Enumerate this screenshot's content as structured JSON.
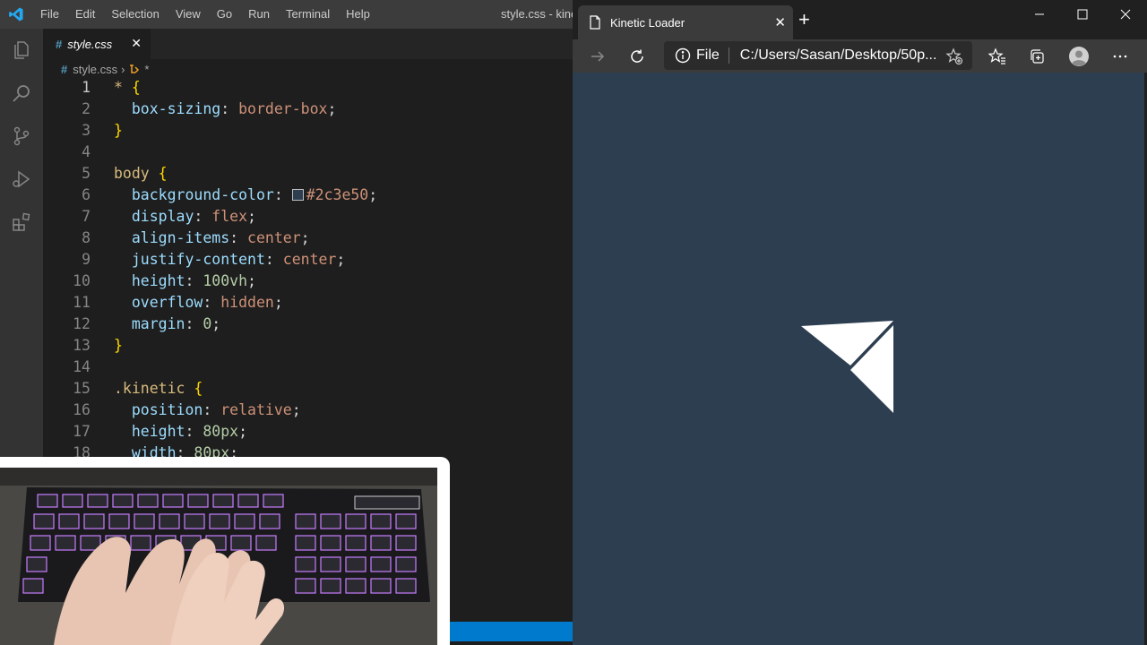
{
  "vscode": {
    "menu": [
      "File",
      "Edit",
      "Selection",
      "View",
      "Go",
      "Run",
      "Terminal",
      "Help"
    ],
    "window_title": "style.css - kinet",
    "tab": {
      "label": "style.css",
      "close": "✕"
    },
    "breadcrumb": {
      "file": "style.css",
      "selector": "*"
    },
    "lines": [
      {
        "n": "1",
        "tokens": [
          [
            "sel",
            "* "
          ],
          [
            "br",
            "{"
          ]
        ]
      },
      {
        "n": "2",
        "tokens": [
          [
            "txt",
            "  "
          ],
          [
            "prop",
            "box-sizing"
          ],
          [
            "txt",
            ": "
          ],
          [
            "val",
            "border-box"
          ],
          [
            "txt",
            ";"
          ]
        ]
      },
      {
        "n": "3",
        "tokens": [
          [
            "br",
            "}"
          ]
        ]
      },
      {
        "n": "4",
        "tokens": []
      },
      {
        "n": "5",
        "tokens": [
          [
            "sel",
            "body "
          ],
          [
            "br",
            "{"
          ]
        ]
      },
      {
        "n": "6",
        "tokens": [
          [
            "txt",
            "  "
          ],
          [
            "prop",
            "background-color"
          ],
          [
            "txt",
            ": "
          ],
          [
            "swatch",
            ""
          ],
          [
            "val",
            "#2c3e50"
          ],
          [
            "txt",
            ";"
          ]
        ]
      },
      {
        "n": "7",
        "tokens": [
          [
            "txt",
            "  "
          ],
          [
            "prop",
            "display"
          ],
          [
            "txt",
            ": "
          ],
          [
            "val",
            "flex"
          ],
          [
            "txt",
            ";"
          ]
        ]
      },
      {
        "n": "8",
        "tokens": [
          [
            "txt",
            "  "
          ],
          [
            "prop",
            "align-items"
          ],
          [
            "txt",
            ": "
          ],
          [
            "val",
            "center"
          ],
          [
            "txt",
            ";"
          ]
        ]
      },
      {
        "n": "9",
        "tokens": [
          [
            "txt",
            "  "
          ],
          [
            "prop",
            "justify-content"
          ],
          [
            "txt",
            ": "
          ],
          [
            "val",
            "center"
          ],
          [
            "txt",
            ";"
          ]
        ]
      },
      {
        "n": "10",
        "tokens": [
          [
            "txt",
            "  "
          ],
          [
            "prop",
            "height"
          ],
          [
            "txt",
            ": "
          ],
          [
            "num",
            "100vh"
          ],
          [
            "txt",
            ";"
          ]
        ]
      },
      {
        "n": "11",
        "tokens": [
          [
            "txt",
            "  "
          ],
          [
            "prop",
            "overflow"
          ],
          [
            "txt",
            ": "
          ],
          [
            "val",
            "hidden"
          ],
          [
            "txt",
            ";"
          ]
        ]
      },
      {
        "n": "12",
        "tokens": [
          [
            "txt",
            "  "
          ],
          [
            "prop",
            "margin"
          ],
          [
            "txt",
            ": "
          ],
          [
            "num",
            "0"
          ],
          [
            "txt",
            ";"
          ]
        ]
      },
      {
        "n": "13",
        "tokens": [
          [
            "br",
            "}"
          ]
        ]
      },
      {
        "n": "14",
        "tokens": []
      },
      {
        "n": "15",
        "tokens": [
          [
            "sel",
            ".kinetic "
          ],
          [
            "br",
            "{"
          ]
        ]
      },
      {
        "n": "16",
        "tokens": [
          [
            "txt",
            "  "
          ],
          [
            "prop",
            "position"
          ],
          [
            "txt",
            ": "
          ],
          [
            "val",
            "relative"
          ],
          [
            "txt",
            ";"
          ]
        ]
      },
      {
        "n": "17",
        "tokens": [
          [
            "txt",
            "  "
          ],
          [
            "prop",
            "height"
          ],
          [
            "txt",
            ": "
          ],
          [
            "num",
            "80px"
          ],
          [
            "txt",
            ";"
          ]
        ]
      },
      {
        "n": "18",
        "tokens": [
          [
            "txt",
            "  "
          ],
          [
            "prop",
            "width"
          ],
          [
            "txt",
            ": "
          ],
          [
            "num",
            "80px"
          ],
          [
            "txt",
            ";"
          ]
        ]
      }
    ]
  },
  "browser": {
    "tab_title": "Kinetic Loader",
    "address_label": "File",
    "url": "C:/Users/Sasan/Desktop/50p...",
    "page_background": "#2c3e50"
  },
  "colors": {
    "accent": "#007acc",
    "page_bg": "#2c3e50"
  }
}
